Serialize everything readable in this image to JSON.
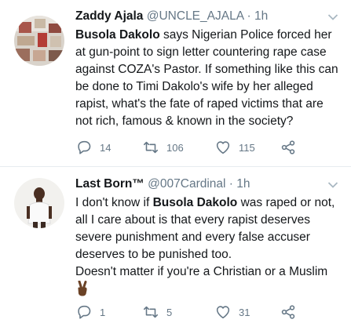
{
  "tweets": [
    {
      "name": "Zaddy Ajala",
      "handle": "@UNCLE_AJALA",
      "separator": "·",
      "time": "1h",
      "text_bold": "Busola Dakolo",
      "text_rest": " says Nigerian Police forced her at gun-point to sign letter countering rape case against COZA's Pastor. If something like this can be done to Timi Dakolo's wife by her alleged rapist, what's the fate of raped victims that are not rich, famous & known in the society?",
      "replies": "14",
      "retweets": "106",
      "likes": "115"
    },
    {
      "name": "Last Born™",
      "handle": "@007Cardinal",
      "separator": "·",
      "time": "1h",
      "text_before": "I don't know if ",
      "text_bold": "Busola Dakolo",
      "text_after": " was raped or not, all I care about is that every rapist deserves severe punishment and every false accuser deserves to be punished too.",
      "text_line2": "Doesn't matter if you're a Christian or a Muslim",
      "emoji": "victory-hand-emoji",
      "replies": "1",
      "retweets": "5",
      "likes": "31"
    }
  ],
  "icons": {
    "reply": "reply-icon",
    "retweet": "retweet-icon",
    "like": "heart-icon",
    "share": "share-icon",
    "menu": "chevron-down-icon"
  },
  "colors": {
    "text": "#14171a",
    "secondary": "#657786",
    "divider": "#e6ecf0"
  }
}
